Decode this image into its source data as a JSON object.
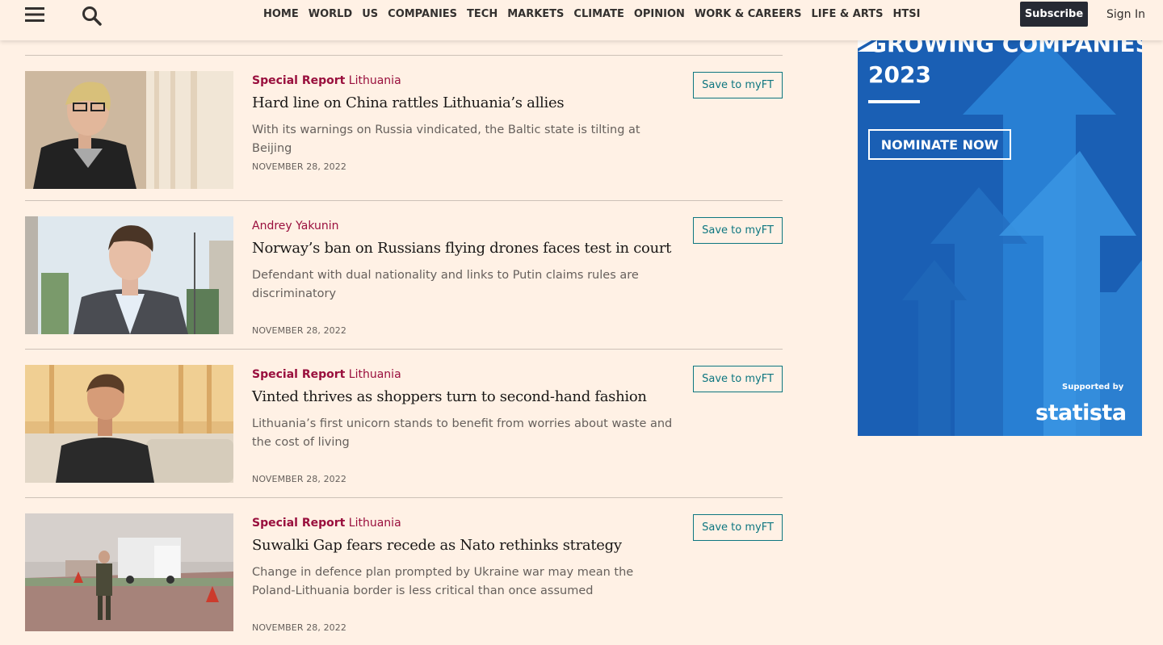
{
  "header": {
    "nav": [
      "HOME",
      "WORLD",
      "US",
      "COMPANIES",
      "TECH",
      "MARKETS",
      "CLIMATE",
      "OPINION",
      "WORK & CAREERS",
      "LIFE & ARTS",
      "HTSI"
    ],
    "subscribe_label": "Subscribe",
    "signin_label": "Sign In",
    "icons": [
      "menu-icon",
      "search-icon"
    ]
  },
  "articles": [
    {
      "kicker_report": "Special Report",
      "kicker_topic": "Lithuania",
      "headline": "Hard line on China rattles Lithuania’s allies",
      "standfirst": "With its warnings on Russia vindicated, the Baltic state is tilting at Beijing",
      "date": "NOVEMBER 28, 2022",
      "save_label": "Save to myFT"
    },
    {
      "kicker_report": "",
      "kicker_topic": "Andrey Yakunin",
      "headline": "Norway’s ban on Russians flying drones faces test in court",
      "standfirst": "Defendant with dual nationality and links to Putin claims rules are discriminatory",
      "date": "NOVEMBER 28, 2022",
      "save_label": "Save to myFT"
    },
    {
      "kicker_report": "Special Report",
      "kicker_topic": "Lithuania",
      "headline": "Vinted thrives as shoppers turn to second-hand fashion",
      "standfirst": "Lithuania’s first unicorn stands to benefit from worries about waste and the cost of living",
      "date": "NOVEMBER 28, 2022",
      "save_label": "Save to myFT"
    },
    {
      "kicker_report": "Special Report",
      "kicker_topic": "Lithuania",
      "headline": "Suwalki Gap fears recede as Nato rethinks strategy",
      "standfirst": "Change in defence plan prompted by Ukraine war may mean the Poland-Lithuania border is less critical than once assumed",
      "date": "NOVEMBER 28, 2022",
      "save_label": "Save to myFT"
    }
  ],
  "ad": {
    "title_line1": "GROWING COMPANIES",
    "title_line2": "2023",
    "cta_label": "NOMINATE NOW",
    "supported_by": "Supported by",
    "sponsor": "statista"
  },
  "colors": {
    "background": "#fff1e5",
    "kicker": "#990f3d",
    "button_teal": "#0d7680",
    "subscribe_bg": "#262a33",
    "ad_blue": "#1860b8"
  }
}
